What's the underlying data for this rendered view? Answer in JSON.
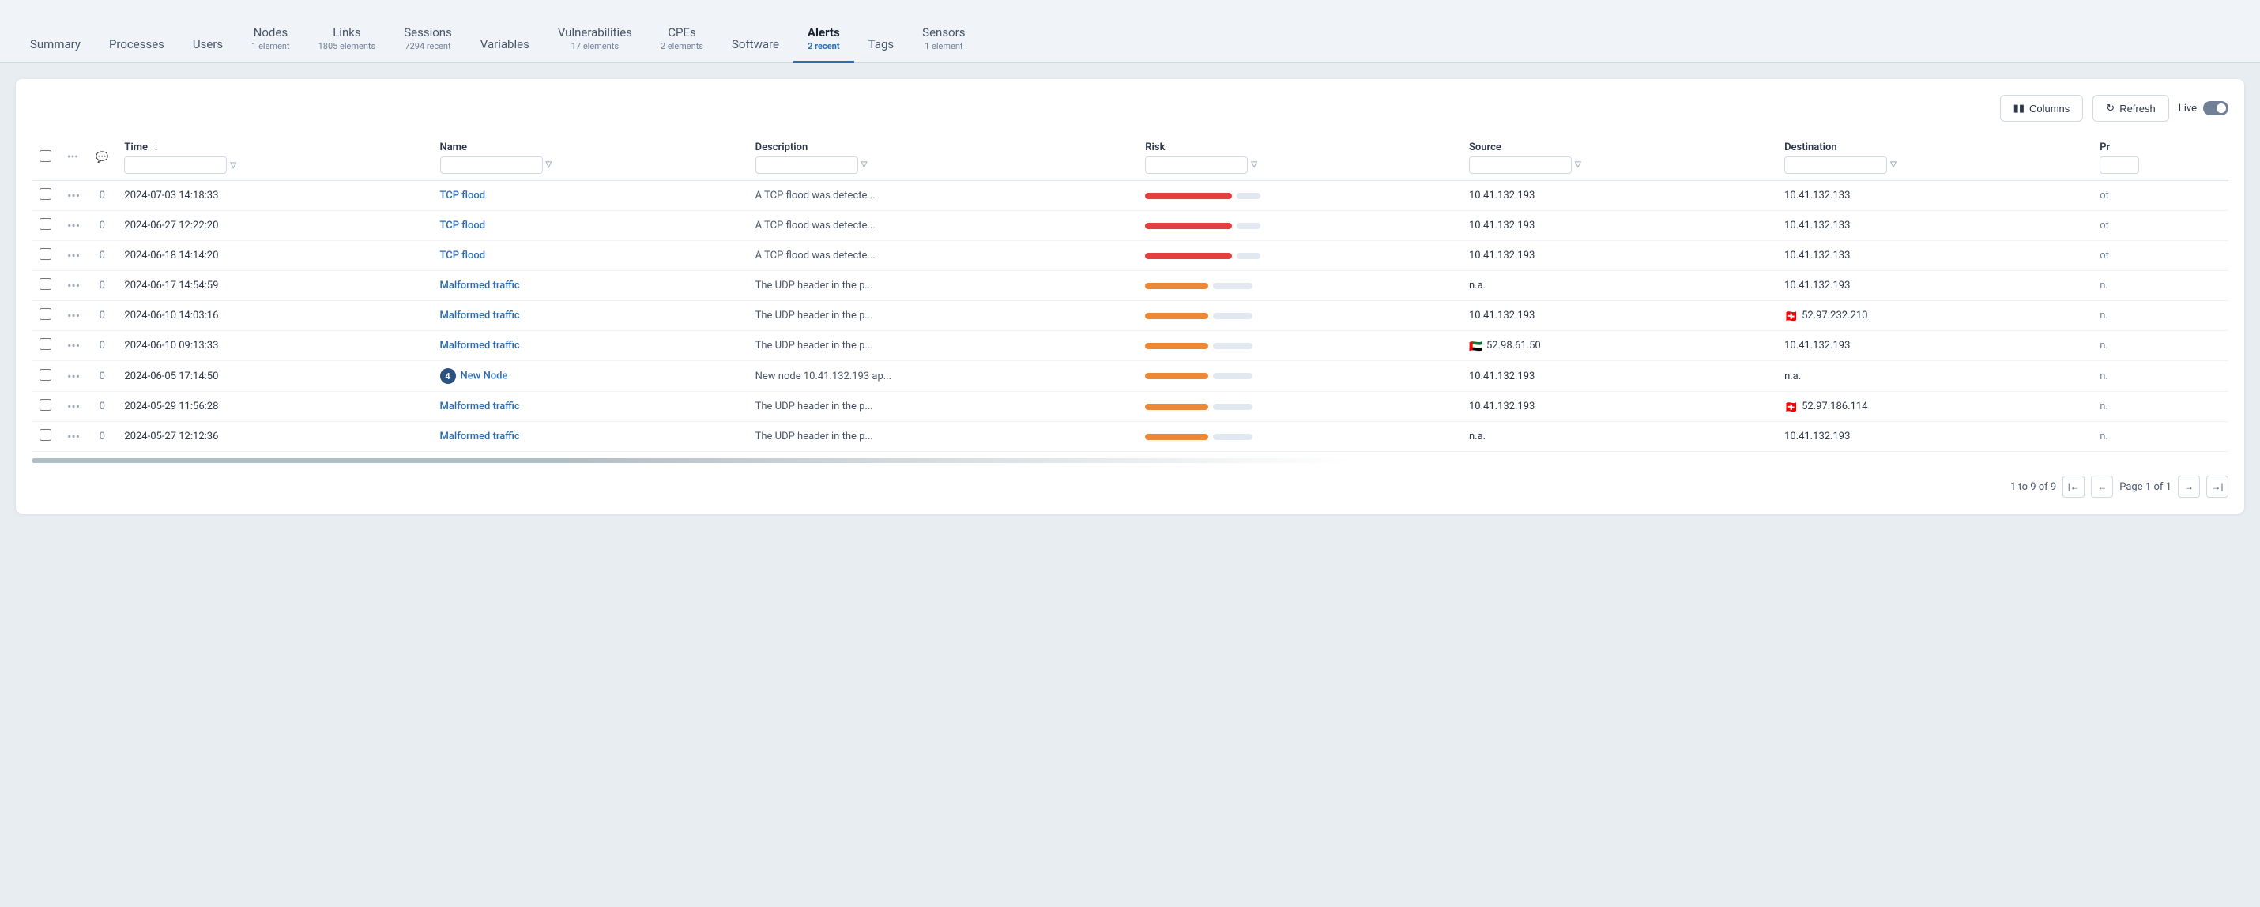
{
  "nav": {
    "items": [
      {
        "id": "summary",
        "label": "Summary",
        "sub": "",
        "active": false
      },
      {
        "id": "processes",
        "label": "Processes",
        "sub": "",
        "active": false
      },
      {
        "id": "users",
        "label": "Users",
        "sub": "",
        "active": false
      },
      {
        "id": "nodes",
        "label": "Nodes",
        "sub": "1 element",
        "active": false
      },
      {
        "id": "links",
        "label": "Links",
        "sub": "1805 elements",
        "active": false
      },
      {
        "id": "sessions",
        "label": "Sessions",
        "sub": "7294 recent",
        "active": false
      },
      {
        "id": "variables",
        "label": "Variables",
        "sub": "",
        "active": false
      },
      {
        "id": "vulnerabilities",
        "label": "Vulnerabilities",
        "sub": "17 elements",
        "active": false
      },
      {
        "id": "cpes",
        "label": "CPEs",
        "sub": "2 elements",
        "active": false
      },
      {
        "id": "software",
        "label": "Software",
        "sub": "",
        "active": false
      },
      {
        "id": "alerts",
        "label": "Alerts",
        "sub": "2 recent",
        "active": true
      },
      {
        "id": "tags",
        "label": "Tags",
        "sub": "",
        "active": false
      },
      {
        "id": "sensors",
        "label": "Sensors",
        "sub": "1 element",
        "active": false
      }
    ]
  },
  "toolbar": {
    "columns_label": "Columns",
    "refresh_label": "Refresh",
    "live_label": "Live"
  },
  "table": {
    "columns": [
      {
        "id": "time",
        "label": "Time",
        "sortable": true
      },
      {
        "id": "name",
        "label": "Name",
        "sortable": false
      },
      {
        "id": "description",
        "label": "Description",
        "sortable": false
      },
      {
        "id": "risk",
        "label": "Risk",
        "sortable": false
      },
      {
        "id": "source",
        "label": "Source",
        "sortable": false
      },
      {
        "id": "destination",
        "label": "Destination",
        "sortable": false
      },
      {
        "id": "pr",
        "label": "Pr",
        "sortable": false
      }
    ],
    "rows": [
      {
        "time": "2024-07-03 14:18:33",
        "name": "TCP flood",
        "name_type": "link",
        "description": "A TCP flood was detecte...",
        "risk": "high",
        "source": "10.41.132.193",
        "source_flag": "",
        "destination": "10.41.132.133",
        "dest_flag": "",
        "pr": "ot",
        "count": "0",
        "badge": ""
      },
      {
        "time": "2024-06-27 12:22:20",
        "name": "TCP flood",
        "name_type": "link",
        "description": "A TCP flood was detecte...",
        "risk": "high",
        "source": "10.41.132.193",
        "source_flag": "",
        "destination": "10.41.132.133",
        "dest_flag": "",
        "pr": "ot",
        "count": "0",
        "badge": ""
      },
      {
        "time": "2024-06-18 14:14:20",
        "name": "TCP flood",
        "name_type": "link",
        "description": "A TCP flood was detecte...",
        "risk": "high",
        "source": "10.41.132.193",
        "source_flag": "",
        "destination": "10.41.132.133",
        "dest_flag": "",
        "pr": "ot",
        "count": "0",
        "badge": ""
      },
      {
        "time": "2024-06-17 14:54:59",
        "name": "Malformed traffic",
        "name_type": "link",
        "description": "The UDP header in the p...",
        "risk": "medium",
        "source": "n.a.",
        "source_flag": "",
        "destination": "10.41.132.193",
        "dest_flag": "",
        "pr": "n.",
        "count": "0",
        "badge": ""
      },
      {
        "time": "2024-06-10 14:03:16",
        "name": "Malformed traffic",
        "name_type": "link",
        "description": "The UDP header in the p...",
        "risk": "medium",
        "source": "10.41.132.193",
        "source_flag": "",
        "destination": "52.97.232.210",
        "dest_flag": "ch",
        "pr": "n.",
        "count": "0",
        "badge": ""
      },
      {
        "time": "2024-06-10 09:13:33",
        "name": "Malformed traffic",
        "name_type": "link",
        "description": "The UDP header in the p...",
        "risk": "medium",
        "source": "52.98.61.50",
        "source_flag": "ae",
        "destination": "10.41.132.193",
        "dest_flag": "",
        "pr": "n.",
        "count": "0",
        "badge": ""
      },
      {
        "time": "2024-06-05 17:14:50",
        "name": "New Node",
        "name_type": "link",
        "description": "New node 10.41.132.193 ap...",
        "risk": "medium",
        "source": "10.41.132.193",
        "source_flag": "",
        "destination": "n.a.",
        "dest_flag": "",
        "pr": "n.",
        "count": "0",
        "badge": "4"
      },
      {
        "time": "2024-05-29 11:56:28",
        "name": "Malformed traffic",
        "name_type": "link",
        "description": "The UDP header in the p...",
        "risk": "medium",
        "source": "10.41.132.193",
        "source_flag": "",
        "destination": "52.97.186.114",
        "dest_flag": "ch",
        "pr": "n.",
        "count": "0",
        "badge": ""
      },
      {
        "time": "2024-05-27 12:12:36",
        "name": "Malformed traffic",
        "name_type": "link",
        "description": "The UDP header in the p...",
        "risk": "medium",
        "source": "n.a.",
        "source_flag": "",
        "destination": "10.41.132.193",
        "dest_flag": "",
        "pr": "n.",
        "count": "0",
        "badge": ""
      }
    ]
  },
  "pagination": {
    "summary": "1 to 9 of 9",
    "page_info": "Page 1 of 1"
  }
}
